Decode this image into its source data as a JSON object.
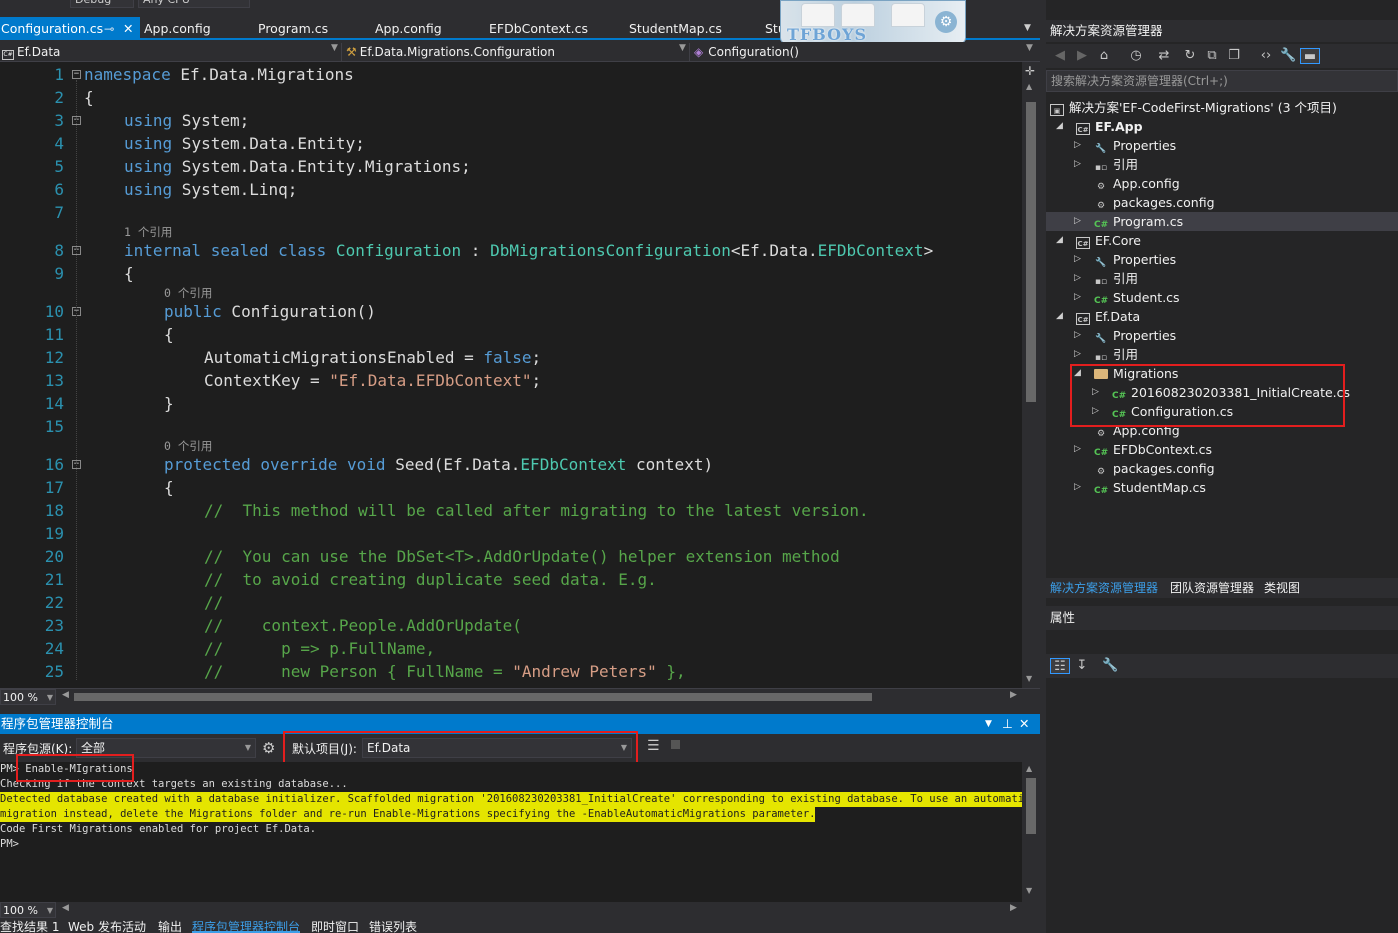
{
  "toolbar": {
    "config": "Debug",
    "platform": "Any CPU"
  },
  "tabs": [
    {
      "label": "Configuration.cs",
      "active": true
    },
    {
      "label": "App.config"
    },
    {
      "label": "Program.cs"
    },
    {
      "label": "App.config"
    },
    {
      "label": "EFDbContext.cs"
    },
    {
      "label": "StudentMap.cs"
    },
    {
      "label": "Stu"
    }
  ],
  "overlay": {
    "logo": "TFBOYS"
  },
  "navbar": {
    "project": "Ef.Data",
    "type": "Ef.Data.Migrations.Configuration",
    "member": "Configuration()"
  },
  "editor": {
    "lines": [
      "1",
      "2",
      "3",
      "4",
      "5",
      "6",
      "7",
      "8",
      "9",
      "10",
      "11",
      "12",
      "13",
      "14",
      "15",
      "16",
      "17",
      "18",
      "19",
      "20",
      "21",
      "22",
      "23",
      "24",
      "25"
    ],
    "refs": {
      "r1": "1 个引用",
      "r2": "0 个引用",
      "r3": "0 个引用"
    },
    "code": {
      "l1a": "namespace",
      "l1b": " Ef.Data.Migrations",
      "l2": "{",
      "using": "using",
      "l3": " System;",
      "l4": " System.Data.Entity;",
      "l5": " System.Data.Entity.Migrations;",
      "l6": " System.Linq;",
      "l8a": "internal sealed class",
      "l8b": " Configuration",
      "l8c": " : ",
      "l8d": "DbMigrationsConfiguration",
      "l8e": "<Ef.Data.",
      "l8f": "EFDbContext",
      "l9": "{",
      "l10a": "public",
      "l10b": " Configuration()",
      "l11": "{",
      "l12a": "AutomaticMigrationsEnabled = ",
      "l12b": "false",
      "l12c": ";",
      "l13a": "ContextKey = ",
      "l13b": "\"Ef.Data.EFDbContext\"",
      "l13c": ";",
      "l14": "}",
      "l16a": "protected override void",
      "l16b": " Seed(Ef.Data.",
      "l16c": "EFDbContext",
      "l16d": " context)",
      "l17": "{",
      "l18": "//  This method will be called after migrating to the latest version.",
      "l20": "//  You can use the DbSet<T>.AddOrUpdate() helper extension method",
      "l21": "//  to avoid creating duplicate seed data. E.g.",
      "l22": "//",
      "l23": "//    context.People.AddOrUpdate(",
      "l24": "//      p => p.FullName,",
      "l25a": "//      new Person { FullName = ",
      "l25b": "\"Andrew Peters\"",
      "l25c": " },"
    },
    "zoom": "100 %"
  },
  "pmc": {
    "title": "程序包管理器控制台",
    "source_label": "程序包源(K):",
    "source_value": "全部",
    "default_label": "默认项目(J):",
    "default_value": "Ef.Data",
    "lines": [
      "PM> Enable-MIgrations",
      "Checking if the context targets an existing database...",
      "Detected database created with a database initializer. Scaffolded migration '201608230203381_InitialCreate' corresponding to existing database. To use an automatic",
      "migration instead, delete the Migrations folder and re-run Enable-Migrations specifying the -EnableAutomaticMigrations parameter.",
      "Code First Migrations enabled for project Ef.Data.",
      "PM>"
    ],
    "zoom": "100 %"
  },
  "bottom_tabs": [
    "查找结果 1",
    "Web 发布活动",
    "输出",
    "程序包管理器控制台",
    "即时窗口",
    "错误列表"
  ],
  "solution": {
    "title": "解决方案资源管理器",
    "search_placeholder": "搜索解决方案资源管理器(Ctrl+;)",
    "root": "解决方案'EF-CodeFirst-Migrations' (3 个项目)",
    "items": [
      {
        "label": "EF.App",
        "icon": "project"
      },
      {
        "label": "Properties",
        "icon": "wrench"
      },
      {
        "label": "引用",
        "icon": "references"
      },
      {
        "label": "App.config",
        "icon": "config"
      },
      {
        "label": "packages.config",
        "icon": "config"
      },
      {
        "label": "Program.cs",
        "icon": "csharp"
      },
      {
        "label": "EF.Core",
        "icon": "project"
      },
      {
        "label": "Properties",
        "icon": "wrench"
      },
      {
        "label": "引用",
        "icon": "references"
      },
      {
        "label": "Student.cs",
        "icon": "csharp"
      },
      {
        "label": "Ef.Data",
        "icon": "project"
      },
      {
        "label": "Properties",
        "icon": "wrench"
      },
      {
        "label": "引用",
        "icon": "references"
      },
      {
        "label": "Migrations",
        "icon": "folder"
      },
      {
        "label": "201608230203381_InitialCreate.cs",
        "icon": "csharp"
      },
      {
        "label": "Configuration.cs",
        "icon": "csharp"
      },
      {
        "label": "App.config",
        "icon": "config"
      },
      {
        "label": "EFDbContext.cs",
        "icon": "csharp"
      },
      {
        "label": "packages.config",
        "icon": "config"
      },
      {
        "label": "StudentMap.cs",
        "icon": "csharp"
      }
    ],
    "tabs": [
      "解决方案资源管理器",
      "团队资源管理器",
      "类视图"
    ],
    "properties_title": "属性"
  },
  "colors": {
    "accent": "#007acc",
    "highlight": "#e5e500",
    "annotation": "#e31e1e"
  }
}
